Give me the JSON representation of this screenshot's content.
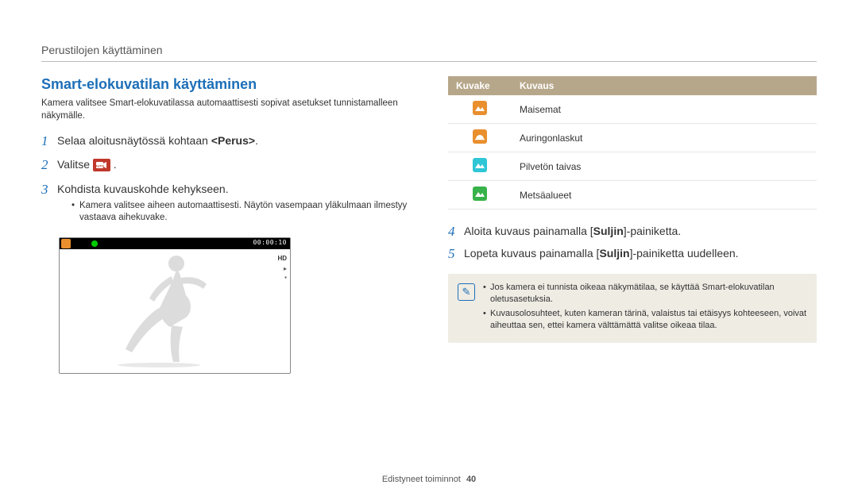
{
  "breadcrumb": "Perustilojen käyttäminen",
  "title": "Smart-elokuvatilan käyttäminen",
  "intro": "Kamera valitsee Smart-elokuvatilassa automaattisesti sopivat asetukset tunnistamalleen näkymälle.",
  "left_steps": {
    "s1": {
      "num": "1",
      "pre": "Selaa aloitusnäytössä kohtaan ",
      "bold": "<Perus>",
      "post": "."
    },
    "s2": {
      "num": "2",
      "pre": "Valitse ",
      "post": "."
    },
    "s3": {
      "num": "3",
      "text": "Kohdista kuvauskohde kehykseen.",
      "sub1": "Kamera valitsee aiheen automaattisesti. Näytön vasempaan yläkulmaan ilmestyy vastaava aihekuvake."
    }
  },
  "display": {
    "rec": "",
    "time": "00:00:10",
    "hd": "HD"
  },
  "table": {
    "h1": "Kuvake",
    "h2": "Kuvaus",
    "rows": [
      {
        "icon": "landscape-icon",
        "cls": "ic-orange",
        "label": "Maisemat"
      },
      {
        "icon": "sunset-icon",
        "cls": "ic-sun",
        "label": "Auringonlaskut"
      },
      {
        "icon": "sky-icon",
        "cls": "ic-cyan",
        "label": "Pilvetön taivas"
      },
      {
        "icon": "forest-icon",
        "cls": "ic-green",
        "label": "Metsäalueet"
      }
    ]
  },
  "right_steps": {
    "s4": {
      "num": "4",
      "pre": "Aloita kuvaus painamalla [",
      "bold": "Suljin",
      "post": "]-painiketta."
    },
    "s5": {
      "num": "5",
      "pre": "Lopeta kuvaus painamalla [",
      "bold": "Suljin",
      "post": "]-painiketta uudelleen."
    }
  },
  "note": {
    "b1": "Jos kamera ei tunnista oikeaa näkymätilaa, se käyttää Smart-elokuvatilan oletusasetuksia.",
    "b2": "Kuvausolosuhteet, kuten kameran tärinä, valaistus tai etäisyys kohteeseen, voivat aiheuttaa sen, ettei kamera välttämättä valitse oikeaa tilaa."
  },
  "footer": {
    "label": "Edistyneet toiminnot",
    "page": "40"
  }
}
